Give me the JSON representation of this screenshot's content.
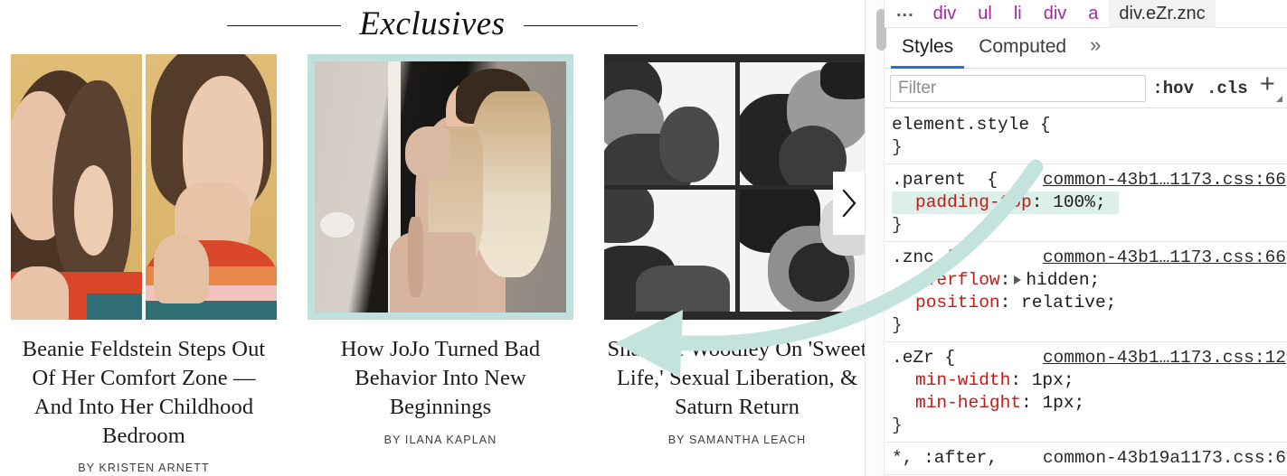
{
  "page": {
    "section": {
      "title": "Exclusives"
    },
    "cards": [
      {
        "title": "Beanie Feldstein Steps Out Of Her Comfort Zone — And Into Her Childhood Bedroom",
        "byline": "BY KRISTEN ARNETT",
        "image_name": "beanie-feldstein-photo",
        "selected": "false"
      },
      {
        "title": "How JoJo Turned Bad Behavior Into New Beginnings",
        "byline": "BY ILANA KAPLAN",
        "image_name": "jojo-photo",
        "selected": "true"
      },
      {
        "title": "Shailene Woodley On 'Sweet Life,' Sexual Liberation, & Saturn Return",
        "byline": "BY SAMANTHA LEACH",
        "image_name": "shailene-woodley-photo",
        "selected": "false"
      }
    ],
    "carousel": {
      "next_label": "›"
    },
    "annotation": {
      "color": "#c5e3dd"
    }
  },
  "devtools": {
    "breadcrumb": [
      {
        "label": "...",
        "selected": "false"
      },
      {
        "label": "div",
        "selected": "false"
      },
      {
        "label": "ul",
        "selected": "false"
      },
      {
        "label": "li",
        "selected": "false"
      },
      {
        "label": "div",
        "selected": "false"
      },
      {
        "label": "a",
        "selected": "false"
      },
      {
        "label": "div.eZr.znc",
        "selected": "true"
      }
    ],
    "tabs": [
      {
        "label": "Styles",
        "active": "true"
      },
      {
        "label": "Computed",
        "active": "false"
      },
      {
        "label": "»",
        "active": "false"
      }
    ],
    "toolbar": {
      "filter_placeholder": "Filter",
      "filter_value": "",
      "hov_label": ":hov",
      "cls_label": ".cls",
      "add_rule_label": "+"
    },
    "rules": [
      {
        "selector": "element.style {",
        "origin": "",
        "declarations": [],
        "close": "}"
      },
      {
        "selector": ".parent  {",
        "origin": "common-43b1…1173.css:66",
        "declarations": [
          {
            "property": "padding-top",
            "value": "100%",
            "highlight": "true",
            "disclosure": "false"
          }
        ],
        "close": "}"
      },
      {
        "selector": ".znc {",
        "origin": "common-43b1…1173.css:66",
        "declarations": [
          {
            "property": "overflow",
            "value": "hidden",
            "highlight": "false",
            "disclosure": "true"
          },
          {
            "property": "position",
            "value": "relative",
            "highlight": "false",
            "disclosure": "false"
          }
        ],
        "close": "}"
      },
      {
        "selector": ".eZr {",
        "origin": "common-43b1…1173.css:12",
        "declarations": [
          {
            "property": "min-width",
            "value": "1px",
            "highlight": "false",
            "disclosure": "false"
          },
          {
            "property": "min-height",
            "value": "1px",
            "highlight": "false",
            "disclosure": "false"
          }
        ],
        "close": "}"
      },
      {
        "selector": "*, :after,",
        "origin": "common-43b19a1173.css:6",
        "declarations": [],
        "close": ""
      }
    ],
    "colors": {
      "tab_accent": "#1a73e8",
      "crumb_tag": "#a626a4",
      "property": "#c41a16",
      "highlight": "#dcefe8"
    }
  }
}
